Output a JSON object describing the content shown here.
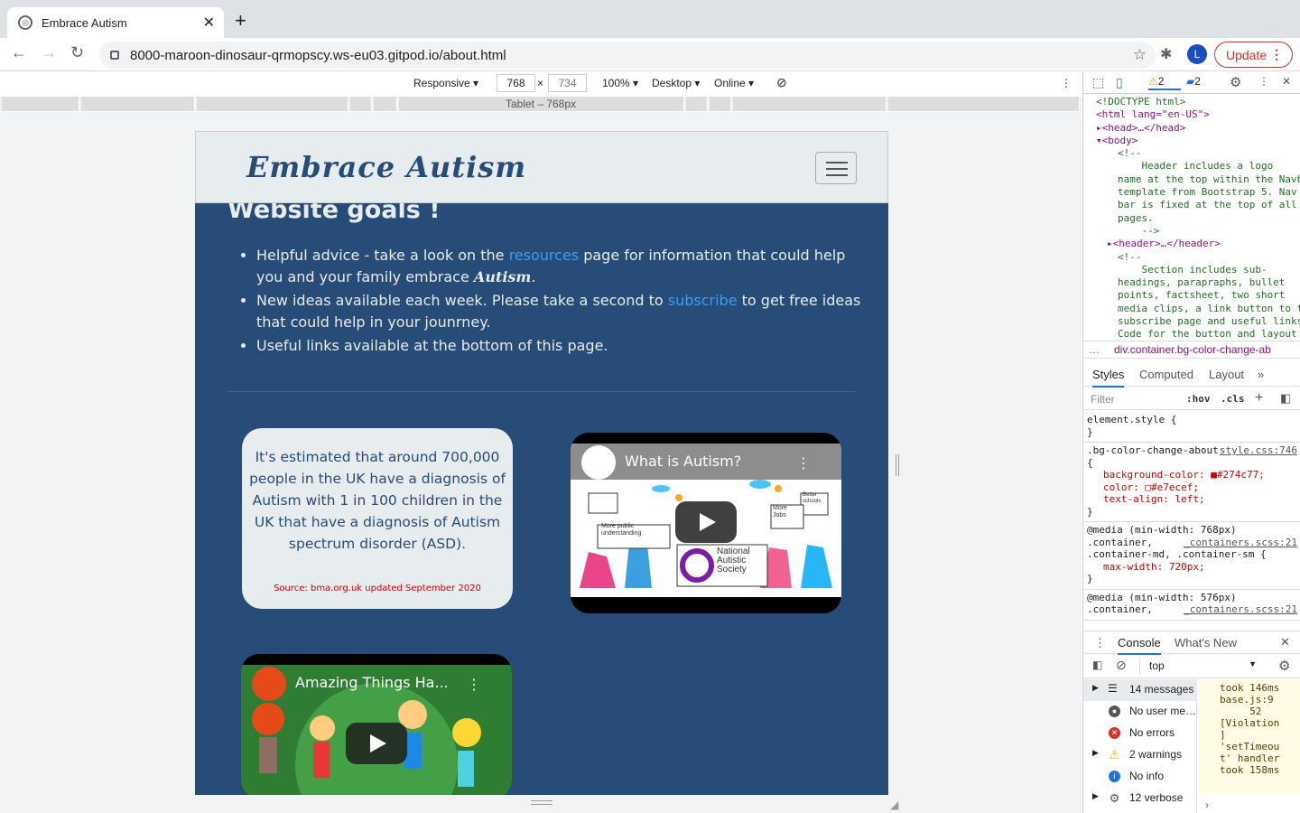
{
  "browser": {
    "tab_title": "Embrace Autism",
    "url": "8000-maroon-dinosaur-qrmopscy.ws-eu03.gitpod.io/about.html",
    "avatar_letter": "L",
    "update_label": "Update"
  },
  "device_toolbar": {
    "mode": "Responsive ▾",
    "width": "768",
    "height": "734",
    "zoom": "100% ▾",
    "device_type": "Desktop ▾",
    "network": "Online ▾",
    "media_label": "Tablet – 768px"
  },
  "page": {
    "brand": "Embrace Autism",
    "goals_heading": "Website goals !",
    "goal1_pre": "Helpful advice - take a look on the ",
    "goal1_link": "resources",
    "goal1_post": " page for information that could help you and your family embrace ",
    "goal1_em": "Autism",
    "goal1_end": ".",
    "goal2_pre": "New ideas available each week. Please take a second to ",
    "goal2_link": "subscribe",
    "goal2_post": " to get free ideas that could help in your jounrney.",
    "goal3": "Useful links available at the bottom of this page.",
    "stat_text": "It's estimated that around 700,000 people in the UK have a diagnosis of Autism with 1 in 100 children in the UK that have a diagnosis of Autism spectrum disorder (ASD).",
    "stat_source": "Source: bma.org.uk updated September 2020",
    "video1_title": "What is Autism?",
    "video1_signs": [
      "National",
      "Autistic",
      "Society",
      "More public understanding",
      "Better schools",
      "More Jobs"
    ],
    "video2_title": "Amazing Things Ha..."
  },
  "devtools": {
    "warnings_count": "2",
    "messages_count": "2",
    "elements_lines": [
      {
        "t": "<!DOCTYPE html>",
        "c": "c",
        "i": 0
      },
      {
        "t": "<html lang=\"en-US\">",
        "i": 0
      },
      {
        "t": "▸<head>…</head>",
        "i": 0
      },
      {
        "t": "▾<body>",
        "i": 0
      },
      {
        "t": "<!--",
        "c": "c",
        "i": 2
      },
      {
        "t": "    Header includes a logo",
        "c": "c",
        "i": 2
      },
      {
        "t": "name at the top within the Navb",
        "c": "c",
        "i": 2
      },
      {
        "t": "template from Bootstrap 5. Nav",
        "c": "c",
        "i": 2
      },
      {
        "t": "bar is fixed at the top of all",
        "c": "c",
        "i": 2
      },
      {
        "t": "pages.",
        "c": "c",
        "i": 2
      },
      {
        "t": "    -->",
        "c": "c",
        "i": 2
      },
      {
        "t": "▸<header>…</header>",
        "i": 1
      },
      {
        "t": "<!--",
        "c": "c",
        "i": 2
      },
      {
        "t": "    Section includes sub-",
        "c": "c",
        "i": 2
      },
      {
        "t": "headings, parapraphs, bullet",
        "c": "c",
        "i": 2
      },
      {
        "t": "points, factsheet, two short",
        "c": "c",
        "i": 2
      },
      {
        "t": "media clips, a link button to t",
        "c": "c",
        "i": 2
      },
      {
        "t": "subscribe page and useful links",
        "c": "c",
        "i": 2
      },
      {
        "t": "Code for the button and layout",
        "c": "c",
        "i": 2
      }
    ],
    "breadcrumb": "div.container.bg-color-change-ab",
    "style_tabs": [
      "Styles",
      "Computed",
      "Layout",
      "»"
    ],
    "filter_placeholder": "Filter",
    "hov": ":hov",
    "cls": ".cls",
    "element_style": "element.style {",
    "rule1_selector": ".bg-color-change-about {",
    "rule1_link": "style.css:746",
    "rule1_props": [
      "background-color: ■#274c77;",
      "color: □#e7ecef;",
      "text-align: left;"
    ],
    "rule2_media": "@media (min-width: 768px)",
    "rule2_selector": ".container, .container-md, .container-sm {",
    "rule2_link": "_containers.scss:21",
    "rule2_props": [
      "max-width: 720px;"
    ],
    "rule3_media": "@media (min-width: 576px)",
    "rule3_selector": ".container,",
    "rule3_link": "_containers.scss:21",
    "console_tabs": [
      "Console",
      "What's New"
    ],
    "console_context": "top",
    "console_side": [
      "14 messages",
      "No user me…",
      "No errors",
      "2 warnings",
      "No info",
      "12 verbose"
    ],
    "console_log": "took 146ms\nbase.js:9\n     52\n[Violation\n]\n'setTimeou\nt' handler\ntook 158ms"
  },
  "colors": {
    "page_bg": "#274c77",
    "navbar_bg": "#e7ecef",
    "link": "#3d9cf5"
  }
}
